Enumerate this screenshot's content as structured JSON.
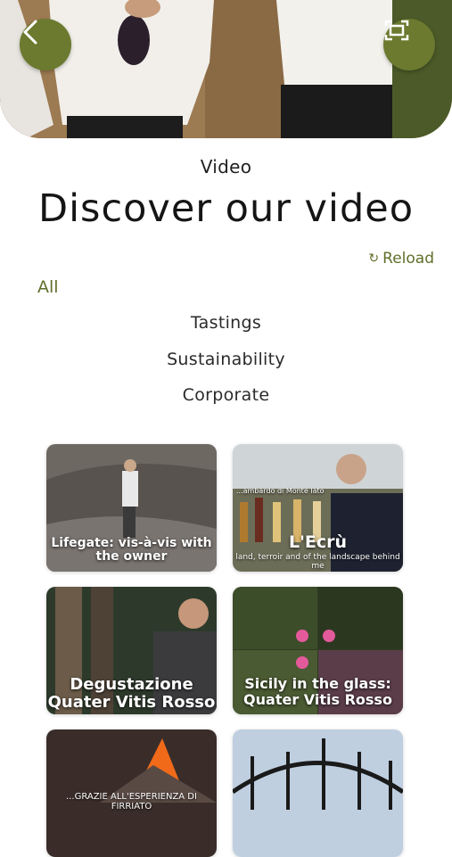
{
  "header": {
    "back_icon": "chevron-left-icon",
    "expand_icon": "fullscreen-icon",
    "accent": "#6b7a2f"
  },
  "section": {
    "kicker": "Video",
    "title": "Discover our video",
    "reload_label": "Reload",
    "reload_icon": "↻"
  },
  "filters": {
    "active": "All",
    "items": [
      "Tastings",
      "Sustainability",
      "Corporate"
    ]
  },
  "videos": [
    {
      "label": "Lifegate: vis-à-vis with the owner"
    },
    {
      "label": "L'Ecrù",
      "caption": "land, terroir and of the landscape behind me",
      "overlay_top": "...ambardo di Monte Iato"
    },
    {
      "label": "Degustazione Quater Vitis Rosso"
    },
    {
      "label": "Sicily in the glass: Quater Vitis Rosso"
    },
    {
      "label": "",
      "caption": "...GRAZIE ALL'ESPERIENZA DI FIRRIATO"
    },
    {
      "label": ""
    }
  ]
}
